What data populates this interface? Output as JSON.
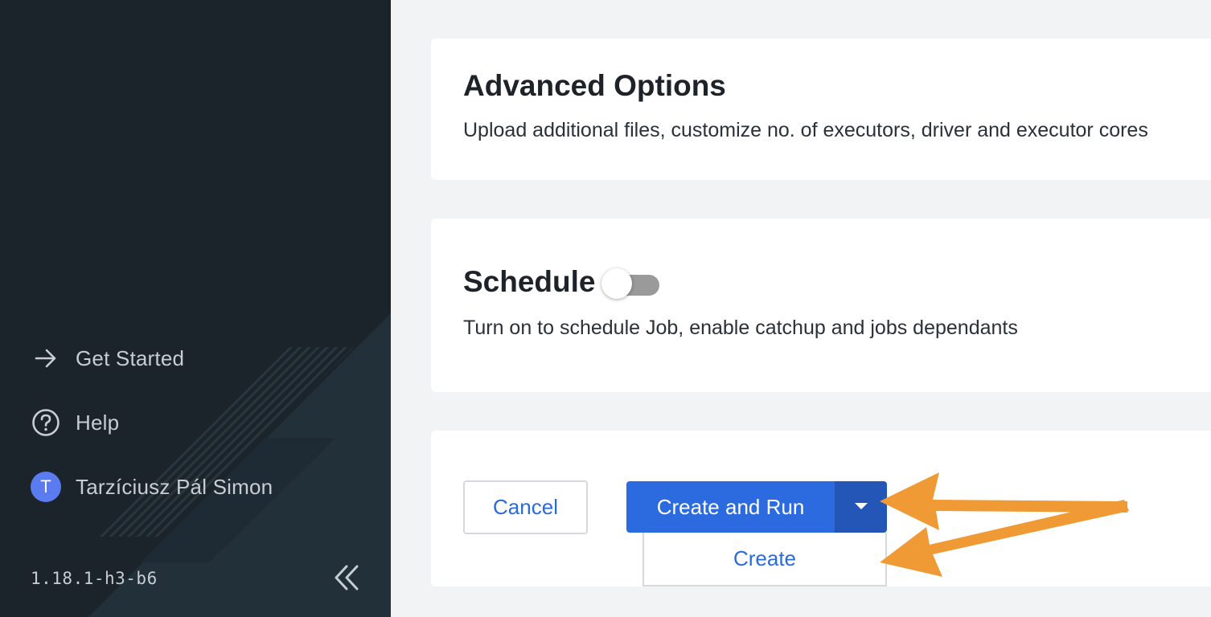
{
  "sidebar": {
    "items": [
      {
        "label": "Get Started",
        "icon": "arrow-right-icon"
      },
      {
        "label": "Help",
        "icon": "help-circle-icon"
      }
    ],
    "user": {
      "initial": "T",
      "name": "Tarzíciusz Pál Simon"
    },
    "version": "1.18.1-h3-b6",
    "collapse_icon": "double-chevron-left-icon"
  },
  "advanced": {
    "title": "Advanced Options",
    "description": "Upload additional files, customize no. of executors, driver and executor cores"
  },
  "schedule": {
    "title": "Schedule",
    "description": "Turn on to schedule Job, enable catchup and jobs dependants",
    "toggle_on": false
  },
  "actions": {
    "cancel_label": "Cancel",
    "primary_label": "Create and Run",
    "caret_icon": "caret-down-icon",
    "dropdown_items": [
      "Create"
    ]
  },
  "colors": {
    "sidebar_bg": "#1b242b",
    "primary": "#2c6bdf",
    "primary_dark": "#2456b8",
    "link": "#2a6bdc",
    "annotation": "#f09a36",
    "avatar": "#5b7cf0"
  }
}
